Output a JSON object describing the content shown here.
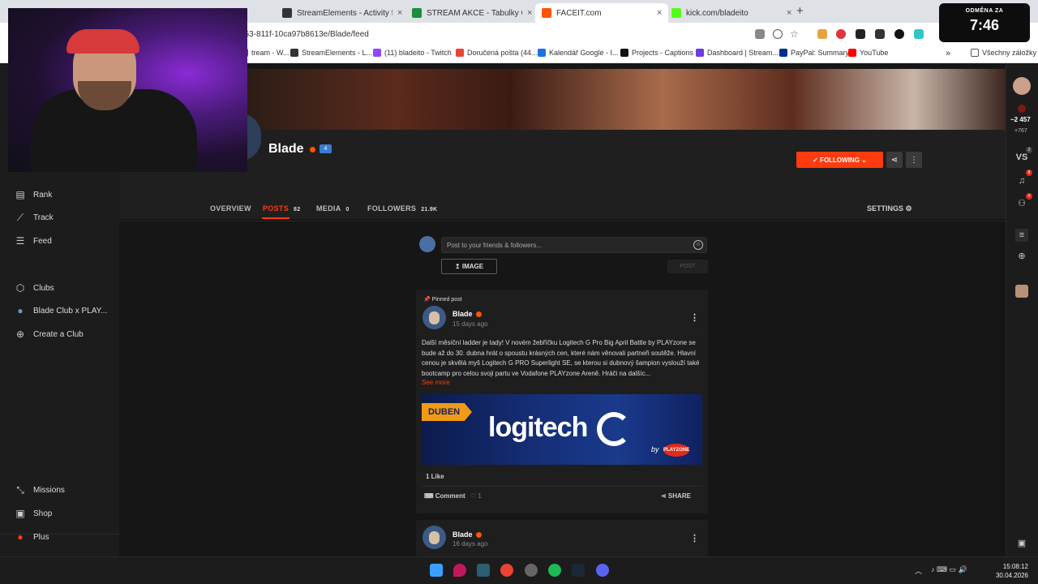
{
  "browser": {
    "tabs": [
      {
        "label": "StreamElements - Activity feed",
        "color": "#333333"
      },
      {
        "label": "STREAM AKCE - Tabulky Google",
        "color": "#1e8e3e"
      },
      {
        "label": "FACEIT.com",
        "color": "#ff5500"
      },
      {
        "label": "kick.com/bladeito",
        "color": "#53fc18"
      }
    ],
    "new_tab": "+",
    "close": "×",
    "url": "353-811f-10ca97b8613e/Blade/feed",
    "bookmarks": [
      {
        "label": "tream - W...",
        "color": "#555555"
      },
      {
        "label": "StreamElements - L...",
        "color": "#333333"
      },
      {
        "label": "(11) bladeito - Twitch",
        "color": "#9146ff"
      },
      {
        "label": "Doručená pošta (44...",
        "color": "#ea4335"
      },
      {
        "label": "Kalendář Google - I...",
        "color": "#1a73e8"
      },
      {
        "label": "Projects - Captions",
        "color": "#111111"
      },
      {
        "label": "Dashboard | Stream...",
        "color": "#6c3ce1"
      },
      {
        "label": "PayPal: Summary",
        "color": "#003087"
      },
      {
        "label": "YouTube",
        "color": "#ff0000"
      }
    ],
    "bookmarks_more": "»",
    "all_bookmarks": "Všechny záložky"
  },
  "timer": {
    "label": "ODMĚNA ZA",
    "value": "7:46"
  },
  "sidebar": {
    "top_items": [
      {
        "label": "Rank",
        "icon": "▤"
      },
      {
        "label": "Track",
        "icon": "⟋"
      },
      {
        "label": "Feed",
        "icon": "☰"
      }
    ],
    "club_items": [
      {
        "label": "Clubs",
        "icon": "⬡"
      },
      {
        "label": "Blade Club x PLAY...",
        "icon": "●"
      },
      {
        "label": "Create a Club",
        "icon": "⊕"
      }
    ],
    "bottom_items": [
      {
        "label": "Missions",
        "icon": "⤡"
      },
      {
        "label": "Shop",
        "icon": "▣"
      },
      {
        "label": "Plus",
        "icon": "●"
      }
    ]
  },
  "profile": {
    "name": "Blade",
    "level": "4",
    "follow_label": "✓ FOLLOWING ⌄",
    "share_icon": "⋖",
    "more_icon": "⋮",
    "tabs": [
      {
        "label": "OVERVIEW",
        "count": ""
      },
      {
        "label": "POSTS",
        "count": "82"
      },
      {
        "label": "MEDIA",
        "count": "0"
      },
      {
        "label": "FOLLOWERS",
        "count": "21.9K"
      }
    ],
    "settings_label": "SETTINGS ⚙"
  },
  "composer": {
    "placeholder": "Post to your friends & followers...",
    "emoji": "☺",
    "image_label": "↥  IMAGE",
    "post_label": "POST"
  },
  "posts": [
    {
      "pinned": "📌 Pinned post",
      "author": "Blade",
      "time": "15 days ago",
      "menu": "⋮",
      "text": "Další měsíční ladder je tady! V novém žebříčku Logitech G Pro Big April Battle by PLAYzone se bude až do 30. dubna hrát o spoustu krásných cen, které nám věnovali partneři soutěže. Hlavní cenou je skvělá myš Logitech G PRO Superlight SE, se kterou si dubnový šampion vyslouží také bootcamp pro celou svoji partu ve Vodafone PLAYzone Areně. Hráči na dalšíc...",
      "see_more": "See more",
      "banner": {
        "tag": "DUBEN",
        "logo": "logitech",
        "by": "by",
        "brand": "PLAYZONE"
      },
      "likes": "1 Like",
      "comment_label": "⌨ Comment",
      "heart": "♡ 1",
      "share_label": "⋖  SHARE"
    },
    {
      "author": "Blade",
      "time": "16 days ago",
      "menu": "⋮"
    }
  ],
  "rail": {
    "points": "~2 457",
    "delta": "+767",
    "vs": "VS",
    "vs_badge": "2",
    "bell_badge": "8",
    "party_badge": "4"
  },
  "taskbar": {
    "time": "15:08:12",
    "date": "30.04.2026",
    "tray_chevron": "︿",
    "tray_icons": "♪ ⌨ ▭ 🔊"
  },
  "colors": {
    "accent": "#ff3b0f",
    "bg": "#161616"
  }
}
